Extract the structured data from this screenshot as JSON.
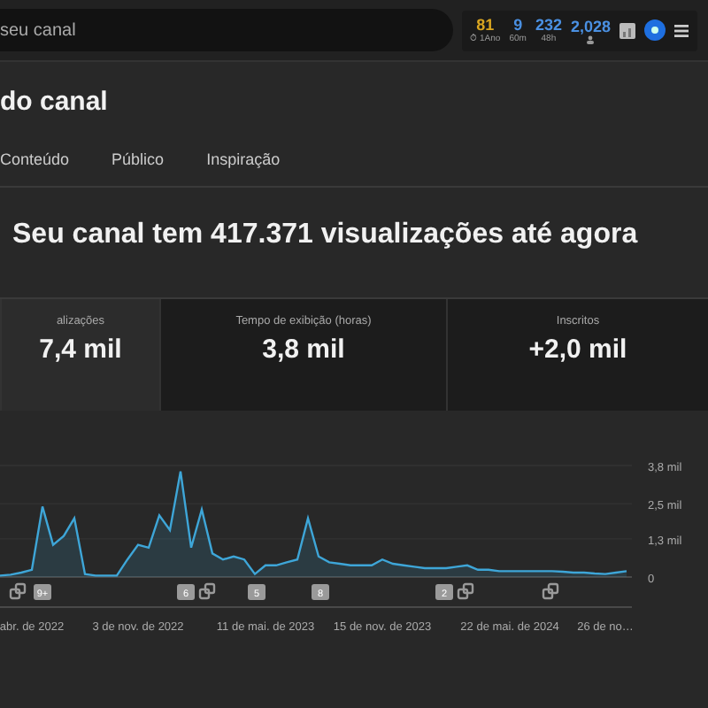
{
  "search": {
    "value": "seu canal"
  },
  "stats_widget": {
    "items": [
      {
        "value": "81",
        "caption": "⏱ 1Ano",
        "color": "#d9a520"
      },
      {
        "value": "9",
        "caption": "60m",
        "color": "#4a90e2"
      },
      {
        "value": "232",
        "caption": "48h",
        "color": "#4a90e2"
      },
      {
        "value": "2,028",
        "color": "#4a90e2"
      }
    ]
  },
  "page_title": "do canal",
  "tabs": [
    {
      "label": "Conteúdo",
      "selected": false
    },
    {
      "label": "Público",
      "selected": false
    },
    {
      "label": "Inspiração",
      "selected": false
    }
  ],
  "headline": "Seu canal tem 417.371 visualizações até agora",
  "metrics": [
    {
      "label": "alizações",
      "value": "7,4 mil",
      "selected": true
    },
    {
      "label": "Tempo de exibição (horas)",
      "value": "3,8 mil",
      "selected": false
    },
    {
      "label": "Inscritos",
      "value": "+2,0 mil",
      "selected": false
    }
  ],
  "chart": {
    "chart_data": {
      "type": "area",
      "categories": [
        null,
        null,
        null,
        "abr. de 2022",
        null,
        null,
        null,
        null,
        null,
        null,
        null,
        null,
        null,
        "3 de nov. de 2022",
        null,
        null,
        null,
        null,
        null,
        null,
        null,
        null,
        null,
        null,
        null,
        "11 de mai. de 2023",
        null,
        null,
        null,
        null,
        null,
        null,
        null,
        null,
        null,
        null,
        "15 de nov. de 2023",
        null,
        null,
        null,
        null,
        null,
        null,
        null,
        null,
        null,
        null,
        null,
        "22 de mai. de 2024",
        null,
        null,
        null,
        null,
        null,
        null,
        null,
        null,
        "26 de no…",
        null,
        null
      ],
      "series": [
        {
          "color": "#3ea6d8",
          "values": [
            0.05,
            0.08,
            0.15,
            0.25,
            2.4,
            1.1,
            1.4,
            2.0,
            0.1,
            0.05,
            0.05,
            0.05,
            0.6,
            1.1,
            1.0,
            2.1,
            1.6,
            3.6,
            1.0,
            2.3,
            0.8,
            0.6,
            0.7,
            0.6,
            0.1,
            0.4,
            0.4,
            0.5,
            0.6,
            2.0,
            0.7,
            0.5,
            0.45,
            0.4,
            0.4,
            0.4,
            0.6,
            0.45,
            0.4,
            0.35,
            0.3,
            0.3,
            0.3,
            0.35,
            0.4,
            0.25,
            0.25,
            0.2,
            0.2,
            0.2,
            0.2,
            0.2,
            0.2,
            0.18,
            0.15,
            0.15,
            0.12,
            0.1,
            0.15,
            0.2
          ]
        }
      ],
      "ylim": [
        0,
        3.8
      ],
      "yticks": [
        {
          "value": 0,
          "label": "0"
        },
        {
          "value": 1.3,
          "label": "1,3 mil"
        },
        {
          "value": 2.5,
          "label": "2,5 mil"
        },
        {
          "value": 3.8,
          "label": "3,8 mil"
        }
      ]
    },
    "markers": [
      {
        "kind": "icon"
      },
      {
        "kind": "badge",
        "label": "9+"
      },
      {
        "kind": "badge",
        "label": "6"
      },
      {
        "kind": "icon"
      },
      {
        "kind": "badge",
        "label": "5"
      },
      {
        "kind": "badge",
        "label": "8"
      },
      {
        "kind": "badge",
        "label": "2"
      },
      {
        "kind": "icon"
      },
      {
        "kind": "icon"
      }
    ]
  }
}
